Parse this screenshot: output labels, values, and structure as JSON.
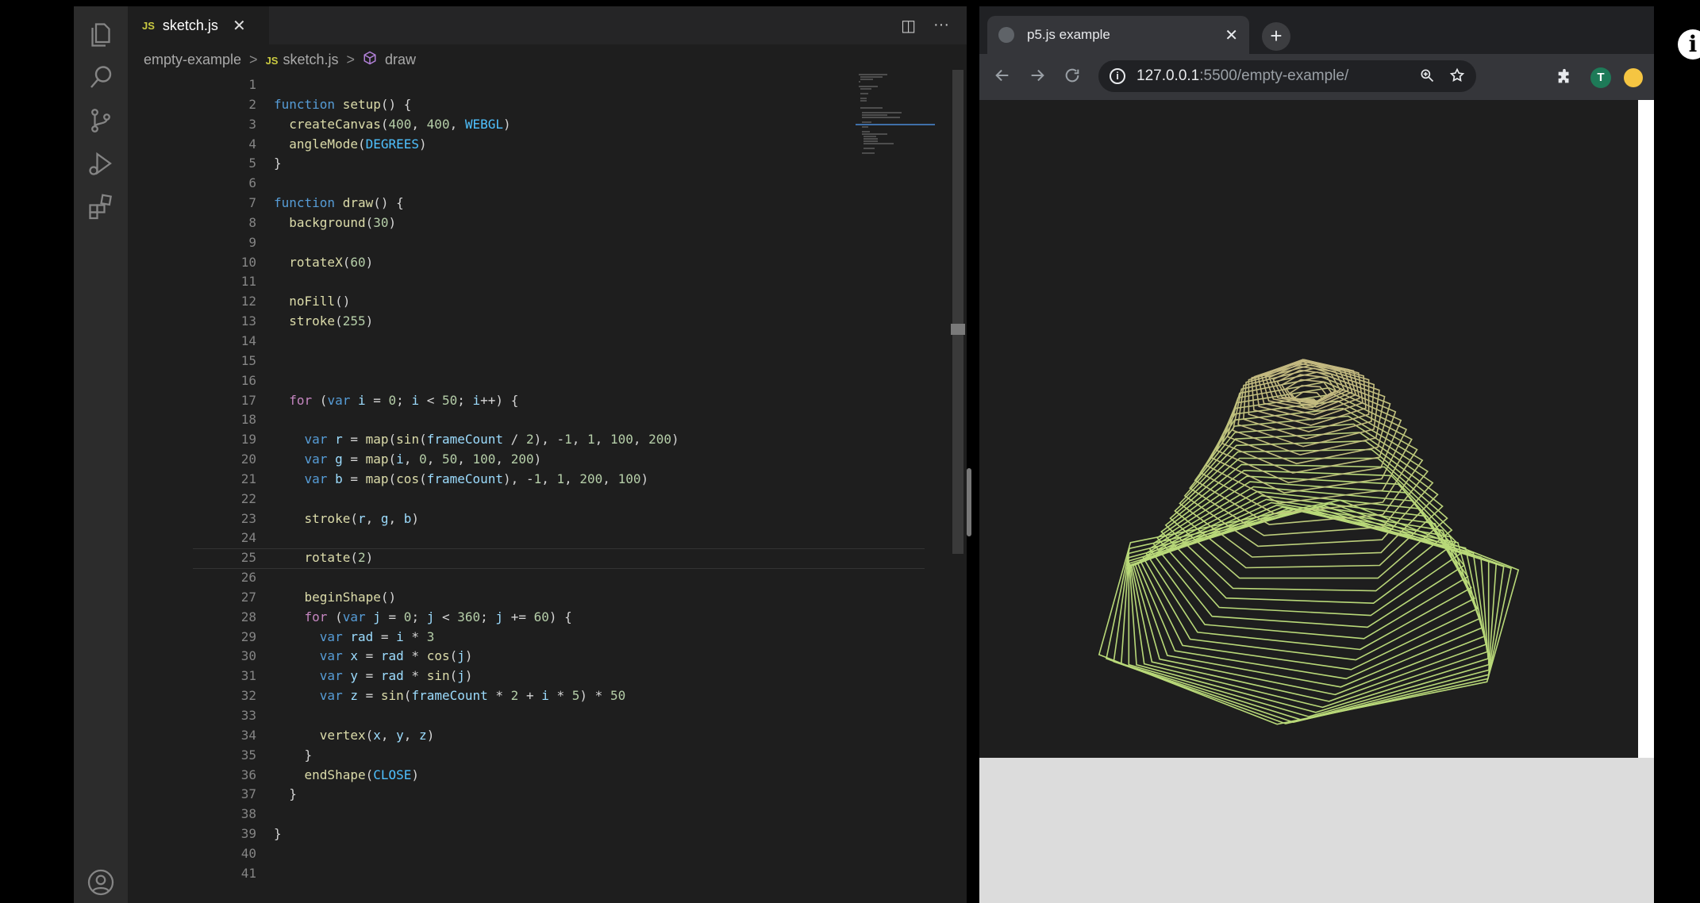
{
  "editor": {
    "tab": {
      "badge": "JS",
      "title": "sketch.js",
      "close": "✕"
    },
    "actions": {
      "split": "◫",
      "more": "···"
    },
    "breadcrumb": {
      "folder": "empty-example",
      "sep": ">",
      "badge": "JS",
      "file": "sketch.js",
      "symbol_icon": "cube-icon",
      "symbol": "draw"
    },
    "code_lines": [
      "",
      "function setup() {",
      "  createCanvas(400, 400, WEBGL)",
      "  angleMode(DEGREES)",
      "}",
      "",
      "function draw() {",
      "  background(30)",
      "",
      "  rotateX(60)",
      "",
      "  noFill()",
      "  stroke(255)",
      "",
      "",
      "",
      "  for (var i = 0; i < 50; i++) {",
      "",
      "    var r = map(sin(frameCount / 2), -1, 1, 100, 200)",
      "    var g = map(i, 0, 50, 100, 200)",
      "    var b = map(cos(frameCount), -1, 1, 200, 100)",
      "",
      "    stroke(r, g, b)",
      "",
      "    rotate(2)",
      "",
      "    beginShape()",
      "    for (var j = 0; j < 360; j += 60) {",
      "      var rad = i * 3",
      "      var x = rad * cos(j)",
      "      var y = rad * sin(j)",
      "      var z = sin(frameCount * 2 + i * 5) * 50",
      "",
      "      vertex(x, y, z)",
      "    }",
      "    endShape(CLOSE)",
      "  }",
      "",
      "}",
      "",
      ""
    ]
  },
  "browser": {
    "tab_title": "p5.js example",
    "tab_close": "✕",
    "new_tab": "+",
    "url_host": "127.0.0.1",
    "url_path": ":5500/empty-example/",
    "profile_initial": "T"
  },
  "sketch": {
    "background": "#1e1e1e",
    "stroke_near": "#b9d979",
    "stroke_far": "#c9a584",
    "ring_count": 50
  },
  "page_info_icon": "i"
}
